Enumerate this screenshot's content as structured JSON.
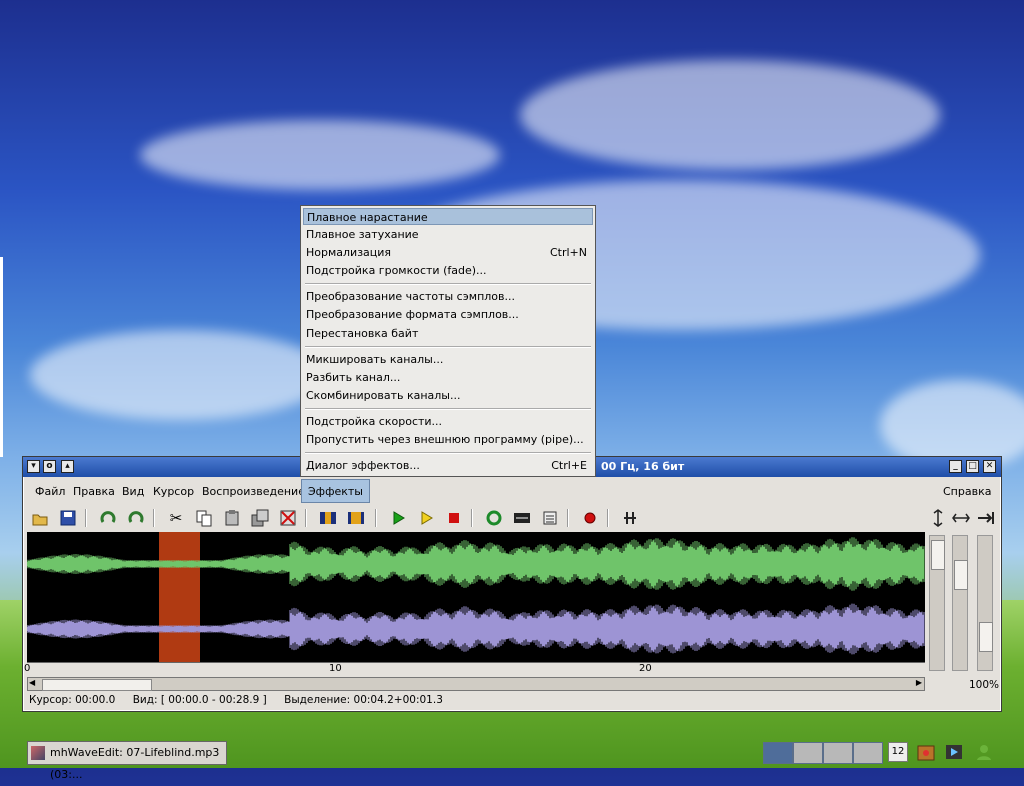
{
  "window": {
    "title_fragment": "00 Гц, 16 бит",
    "menus": [
      "Файл",
      "Правка",
      "Вид",
      "Курсор",
      "Воспроизведение",
      "Эффекты"
    ],
    "help": "Справка",
    "ruler": [
      "0",
      "10",
      "20"
    ],
    "zoom": "100%",
    "status": {
      "cursor": "Курсор: 00:00.0",
      "view": "Вид: [ 00:00.0 - 00:28.9 ]",
      "selection": "Выделение: 00:04.2+00:01.3"
    }
  },
  "effects_menu": {
    "items": [
      {
        "label": "Плавное нарастание",
        "accel": ""
      },
      {
        "label": "Плавное затухание",
        "accel": ""
      },
      {
        "label": "Нормализация",
        "accel": "Ctrl+N"
      },
      {
        "label": "Подстройка громкости (fade)...",
        "accel": ""
      },
      {
        "label": "Преобразование частоты сэмплов...",
        "accel": ""
      },
      {
        "label": "Преобразование формата сэмплов...",
        "accel": ""
      },
      {
        "label": "Перестановка байт",
        "accel": ""
      },
      {
        "label": "Микшировать каналы...",
        "accel": ""
      },
      {
        "label": "Разбить канал...",
        "accel": ""
      },
      {
        "label": "Скомбинировать каналы...",
        "accel": ""
      },
      {
        "label": "Подстройка скорости...",
        "accel": ""
      },
      {
        "label": "Пропустить через внешнюю программу (pipe)...",
        "accel": ""
      },
      {
        "label": "Диалог эффектов...",
        "accel": "Ctrl+E"
      }
    ]
  },
  "taskbar": {
    "task_label": "mhWaveEdit: 07-Lifeblind.mp3 (03:...",
    "clock_day": "12"
  },
  "colors": {
    "wave_left": "#6fc46a",
    "wave_right": "#9d94d4",
    "selection": "#b03a12"
  }
}
